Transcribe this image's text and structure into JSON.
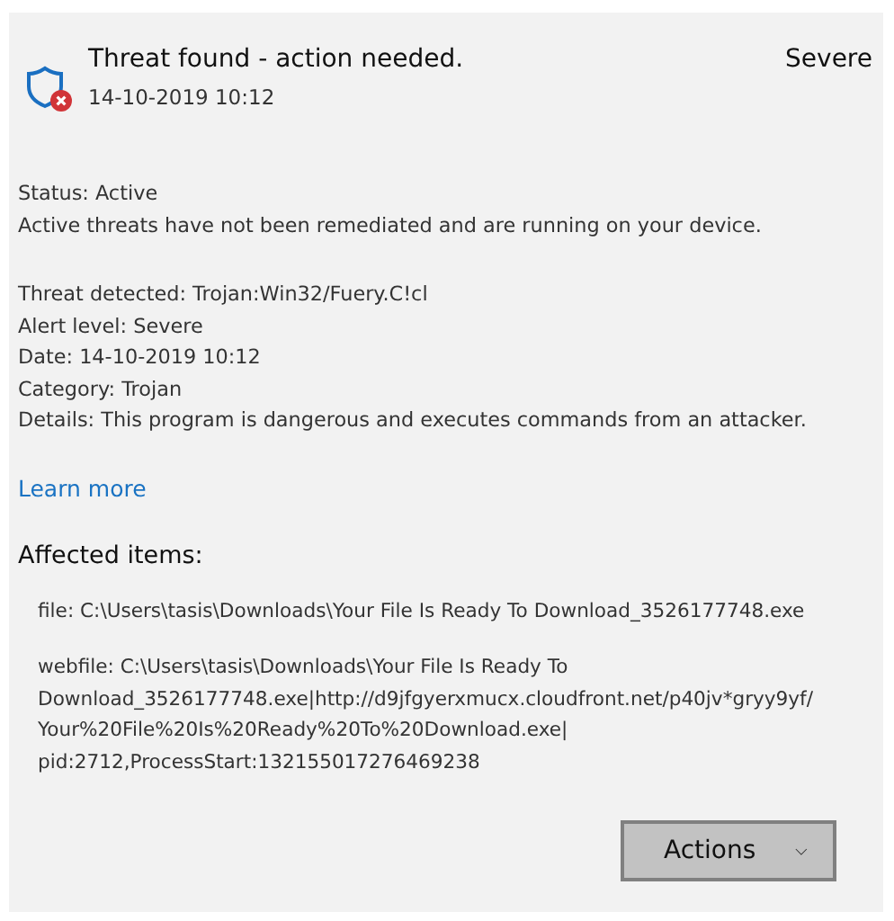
{
  "header": {
    "title": "Threat found - action needed.",
    "date": "14-10-2019 10:12",
    "severity": "Severe"
  },
  "status": {
    "line": "Status:  Active",
    "description": "Active threats have not been remediated and are running on your device."
  },
  "details": [
    "Threat detected:  Trojan:Win32/Fuery.C!cl",
    "Alert level:  Severe",
    "Date:  14-10-2019 10:12",
    "Category:  Trojan",
    "Details:  This program is dangerous and executes commands from an attacker."
  ],
  "learn_more": "Learn more",
  "affected": {
    "heading": "Affected items:",
    "items": [
      "file: C:\\Users\\tasis\\Downloads\\Your File Is Ready To Download_3526177748.exe",
      "webfile: C:\\Users\\tasis\\Downloads\\Your File Is Ready To Download_3526177748.exe|http://d9jfgyerxmucx.cloudfront.net/p40jv*gryy9yf/ Your%20File%20Is%20Ready%20To%20Download.exe| pid:2712,ProcessStart:132155017276469238"
    ]
  },
  "actions_button": "Actions"
}
